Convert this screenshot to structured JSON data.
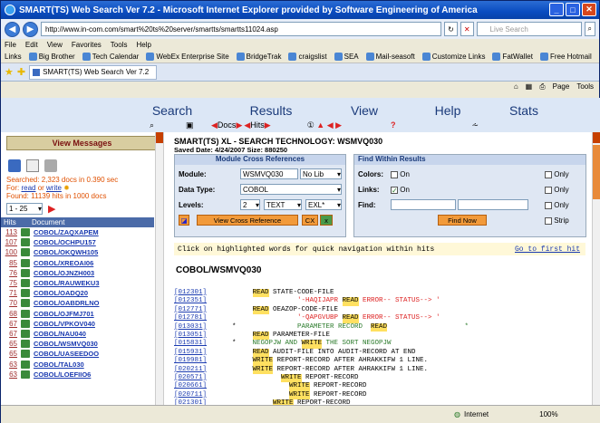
{
  "browser": {
    "title": "SMART(TS) Web Search Ver 7.2 - Microsoft Internet Explorer provided by Software Engineering of America",
    "url": "http://www.in-com.com/smart%20ts%20server/smartts/smartts11024.asp",
    "search_placeholder": "Live Search",
    "menu": [
      "File",
      "Edit",
      "View",
      "Favorites",
      "Tools",
      "Help"
    ],
    "links_label": "Links",
    "links": [
      "Big Brother",
      "Tech Calendar",
      "WebEx Enterprise Site",
      "BridgeTrak",
      "craigslist",
      "SEA",
      "Mail-seasoft",
      "Customize Links",
      "FatWallet",
      "Free Hotmail"
    ],
    "tab_title": "SMART(TS) Web Search Ver 7.2",
    "tab_tools": [
      "Page",
      "Tools"
    ],
    "status_zone": "Internet",
    "zoom": "100%"
  },
  "appnav": {
    "items": [
      "Search",
      "Results",
      "View",
      "Help",
      "Stats"
    ],
    "results_sub": [
      "Docs",
      "Hits"
    ]
  },
  "left": {
    "view_messages": "View Messages",
    "searched": "Searched: 2,323 docs in 0.390 sec",
    "for_prefix": "For: ",
    "for_read": "read",
    "for_or": " or ",
    "for_write": "write",
    "found": "Found: 11139 hits in 1000 docs",
    "range": "1 - 25",
    "col_hits": "Hits",
    "col_doc": "Document",
    "rows": [
      {
        "n": "113",
        "doc": "COBOL/ZAQXAPEM"
      },
      {
        "n": "107",
        "doc": "COBOL/OCHPU157"
      },
      {
        "n": "100",
        "doc": "COBOL/OKQWH105"
      },
      {
        "n": "85",
        "doc": "COBOL/XREOAI06"
      },
      {
        "n": "76",
        "doc": "COBOL/OJNZH003"
      },
      {
        "n": "75",
        "doc": "COBOL/RAUWEKU3"
      },
      {
        "n": "71",
        "doc": "COBOL/OADQ20"
      },
      {
        "n": "70",
        "doc": "COBOL/OABDRLNO"
      },
      {
        "n": "68",
        "doc": "COBOL/OJFMJ701"
      },
      {
        "n": "67",
        "doc": "COBOL/VPKOV040"
      },
      {
        "n": "67",
        "doc": "COBOL/NAU040"
      },
      {
        "n": "65",
        "doc": "COBOL/WSMVQ030"
      },
      {
        "n": "65",
        "doc": "COBOL/UASEEDOO"
      },
      {
        "n": "63",
        "doc": "COBOL/TAL030"
      },
      {
        "n": "63",
        "doc": "COBOL/LOEFIIO6"
      }
    ]
  },
  "main": {
    "title": "SMART(TS) XL - SEARCH TECHNOLOGY: WSMVQ030",
    "saved": "Saved Date: 4/24/2007 Size: 880250",
    "xref": {
      "title": "Module Cross References",
      "module_label": "Module:",
      "module_value": "WSMVQ030",
      "nolib": "No Lib",
      "datatype_label": "Data Type:",
      "datatype_value": "COBOL",
      "levels_label": "Levels:",
      "levels_value": "2",
      "text_value": "TEXT",
      "exl_value": "EXL*",
      "view_btn": "View Cross Reference",
      "cx": "CX"
    },
    "find": {
      "title": "Find Within Results",
      "colors_label": "Colors:",
      "links_label": "Links:",
      "find_label": "Find:",
      "on": "On",
      "only": "Only",
      "strip": "Strip",
      "find_now": "Find Now"
    },
    "hint": "Click on highlighted words for quick navigation within hits",
    "go_first": "Go to first hit",
    "file_name": "COBOL/WSMVQ030",
    "code": [
      {
        "ref": "[012301]",
        "pad": "         ",
        "kw": "READ",
        "rest": " STATE-CODE-FILE"
      },
      {
        "ref": "[012351]",
        "pad": "                    ",
        "pre": "'-HAQIJAPR ",
        "kw": "READ",
        "rest": " ERROR-- STATUS--> '",
        "red": true
      },
      {
        "ref": "[012771]",
        "pad": "         ",
        "kw": "READ",
        "rest": " OEAZOP-CODE-FILE"
      },
      {
        "ref": "[012781]",
        "pad": "                    ",
        "pre": "'-QAPGVUBP ",
        "kw": "READ",
        "rest": " ERROR-- STATUS--> '",
        "red": true
      },
      {
        "ref": "[013031]",
        "pad": "    *               ",
        "pre": "PARAMETER RECORD  ",
        "kw": "READ",
        "rest": "                   *",
        "green": true
      },
      {
        "ref": "[013051]",
        "pad": "         ",
        "kw": "READ",
        "rest": " PARAMETER-FILE"
      },
      {
        "ref": "[015831]",
        "pad": "    *    ",
        "pre": "NEGOPJW AND ",
        "kw": "WRITE",
        "rest": " THE SORT NEGOPJW",
        "green": true
      },
      {
        "ref": "[015931]",
        "pad": "         ",
        "kw": "READ",
        "rest": " AUDIT-FILE INTO AUDIT-RECORD AT END"
      },
      {
        "ref": "[019981]",
        "pad": "         ",
        "kw": "WRITE",
        "rest": " REPORT-RECORD AFTER AHRAKKIFW 1 LINE."
      },
      {
        "ref": "[020211]",
        "pad": "         ",
        "kw": "WRITE",
        "rest": " REPORT-RECORD AFTER AHRAKKIFW 1 LINE."
      },
      {
        "ref": "[020571]",
        "pad": "                ",
        "kw": "WRITE",
        "rest": " REPORT-RECORD"
      },
      {
        "ref": "[020661]",
        "pad": "                  ",
        "kw": "WRITE",
        "rest": " REPORT-RECORD"
      },
      {
        "ref": "[020711]",
        "pad": "                  ",
        "kw": "WRITE",
        "rest": " REPORT-RECORD"
      },
      {
        "ref": "[021301]",
        "pad": "              ",
        "kw": "WRITE",
        "rest": " REPORT-RECORD"
      }
    ]
  }
}
